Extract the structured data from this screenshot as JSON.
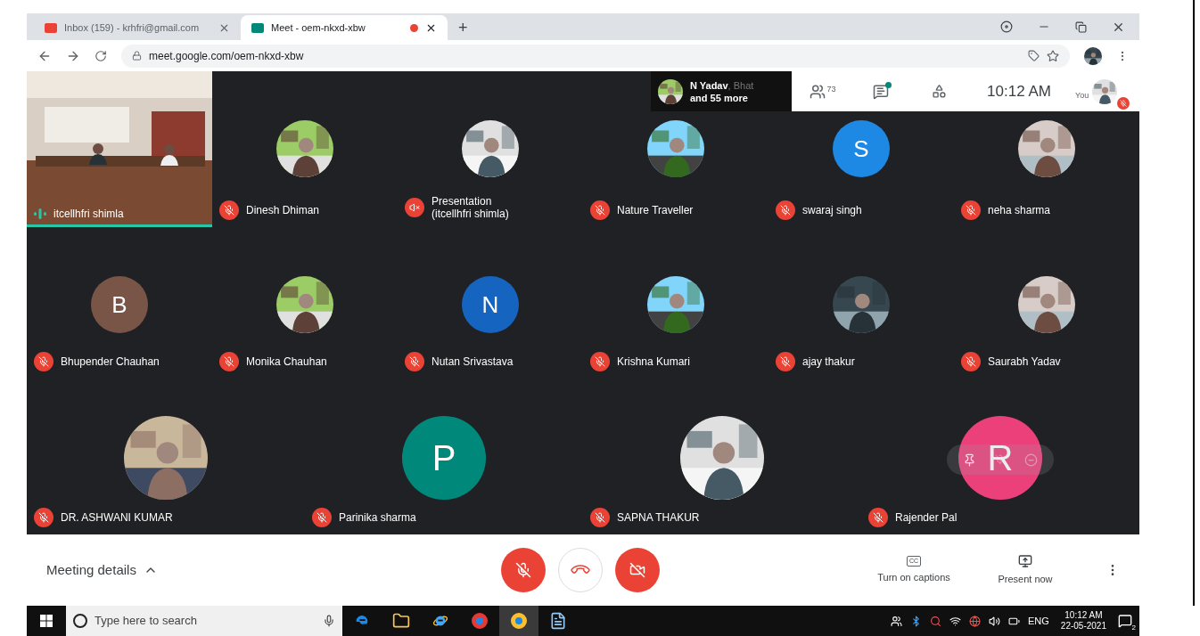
{
  "browser": {
    "tabs": [
      {
        "title": "Inbox (159) - krhfri@gmail.com",
        "selected": false,
        "recording": false
      },
      {
        "title": "Meet - oem-nkxd-xbw",
        "selected": true,
        "recording": true
      }
    ],
    "new_tab": "+",
    "address": "meet.google.com/oem-nkxd-xbw"
  },
  "meet_header": {
    "preview_names": "N Yadav",
    "preview_more_names": ", Bhat",
    "preview_more": "and 55 more",
    "people_count": "73",
    "chat_unread": true,
    "time": "10:12 AM",
    "self_label": "You",
    "self_muted": true
  },
  "grid_rows": [
    {
      "tiles": [
        {
          "kind": "participant",
          "name": "itcellhfri shimla",
          "avatar": {
            "kind": "video"
          },
          "speaking": true,
          "muted": false
        },
        {
          "kind": "participant",
          "name": "Dinesh Dhiman",
          "speaking": false,
          "muted": true
        },
        {
          "kind": "presentation",
          "name": "Presentation\n(itcellhfri shimla)",
          "speaking": false,
          "muted": true
        },
        {
          "kind": "participant",
          "name": "Nature Traveller",
          "speaking": false,
          "muted": true
        },
        {
          "kind": "participant",
          "name": "swaraj singh",
          "avatar": {
            "kind": "letter",
            "letter": "S",
            "color": "#1e88e5"
          },
          "speaking": false,
          "muted": true
        },
        {
          "kind": "participant",
          "name": "neha sharma",
          "speaking": false,
          "muted": true
        }
      ]
    },
    {
      "tiles": [
        {
          "kind": "participant",
          "name": "Bhupender Chauhan",
          "avatar": {
            "kind": "letter",
            "letter": "B",
            "color": "#795548"
          },
          "speaking": false,
          "muted": true
        },
        {
          "kind": "participant",
          "name": "Monika Chauhan",
          "speaking": false,
          "muted": true
        },
        {
          "kind": "participant",
          "name": "Nutan Srivastava",
          "avatar": {
            "kind": "letter",
            "letter": "N",
            "color": "#1565c0"
          },
          "speaking": false,
          "muted": true
        },
        {
          "kind": "participant",
          "name": "Krishna Kumari",
          "speaking": false,
          "muted": true
        },
        {
          "kind": "participant",
          "name": "ajay thakur",
          "speaking": false,
          "muted": true
        },
        {
          "kind": "participant",
          "name": "Saurabh Yadav",
          "speaking": false,
          "muted": true
        }
      ]
    },
    {
      "tiles": [
        {
          "kind": "participant",
          "name": "DR. ASHWANI KUMAR",
          "speaking": false,
          "muted": true
        },
        {
          "kind": "participant",
          "name": "Parinika sharma",
          "avatar": {
            "kind": "letter",
            "letter": "P",
            "color": "#00897b"
          },
          "speaking": false,
          "muted": true
        },
        {
          "kind": "participant",
          "name": "SAPNA THAKUR",
          "speaking": false,
          "muted": true
        },
        {
          "kind": "participant",
          "name": "Rajender Pal",
          "avatar": {
            "kind": "letter",
            "letter": "R",
            "color": "#ec407a"
          },
          "speaking": false,
          "muted": true,
          "hover_controls": true
        }
      ]
    }
  ],
  "controls": {
    "meeting_details": "Meeting details",
    "mic_on": false,
    "camera_on": false,
    "captions": "Turn on captions",
    "captions_icon": "CC",
    "present": "Present now"
  },
  "taskbar": {
    "search_placeholder": "Type here to search",
    "language": "ENG",
    "time": "10:12 AM",
    "date": "22-05-2021",
    "notifications": "2"
  }
}
